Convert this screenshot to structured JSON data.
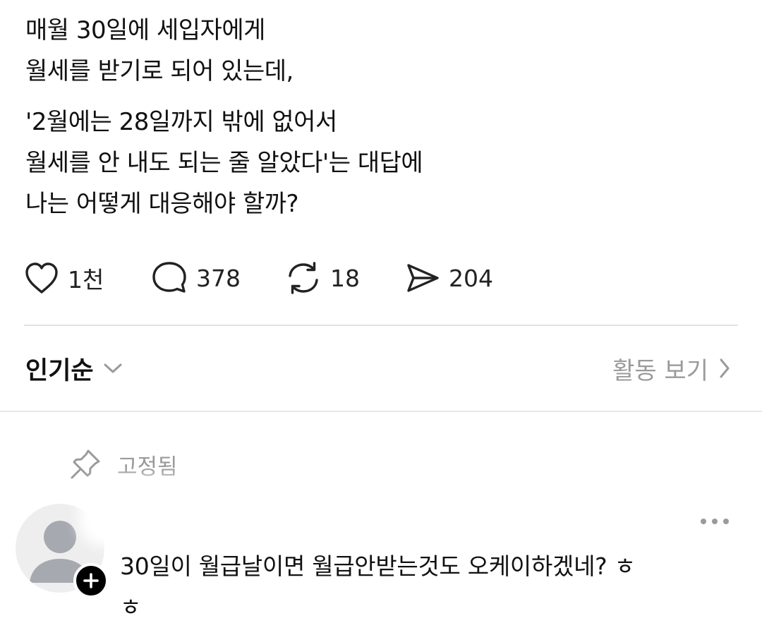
{
  "post": {
    "paragraphs": [
      {
        "lines": [
          "매월 30일에 세입자에게",
          "월세를 받기로 되어 있는데,"
        ]
      },
      {
        "lines": [
          "'2월에는 28일까지 밖에 없어서",
          "월세를 안 내도 되는 줄 알았다'는 대답에",
          "나는 어떻게 대응해야 할까?"
        ]
      }
    ]
  },
  "actions": {
    "like": {
      "icon": "heart-icon",
      "count": "1천"
    },
    "reply": {
      "icon": "comment-bubble-icon",
      "count": "378"
    },
    "repost": {
      "icon": "repost-icon",
      "count": "18"
    },
    "share": {
      "icon": "send-icon",
      "count": "204"
    }
  },
  "sort": {
    "label": "인기순",
    "icon": "chevron-down-icon",
    "activity_label": "활동 보기",
    "activity_icon": "chevron-right-icon"
  },
  "comment": {
    "pinned_label": "고정됨",
    "pinned_icon": "pin-icon",
    "avatar_icon": "default-avatar-icon",
    "add_icon": "plus-icon",
    "more_icon": "more-horizontal-icon",
    "lines": [
      "30일이 월급날이면 월급안받는것도 오케이하겠네? ㅎ",
      "ㅎ"
    ]
  },
  "colors": {
    "text": "#111111",
    "muted": "#9a9a9a",
    "divider": "#e3e3e3",
    "avatar_bg": "#eeeeef",
    "avatar_fg": "#a7a9b0"
  }
}
